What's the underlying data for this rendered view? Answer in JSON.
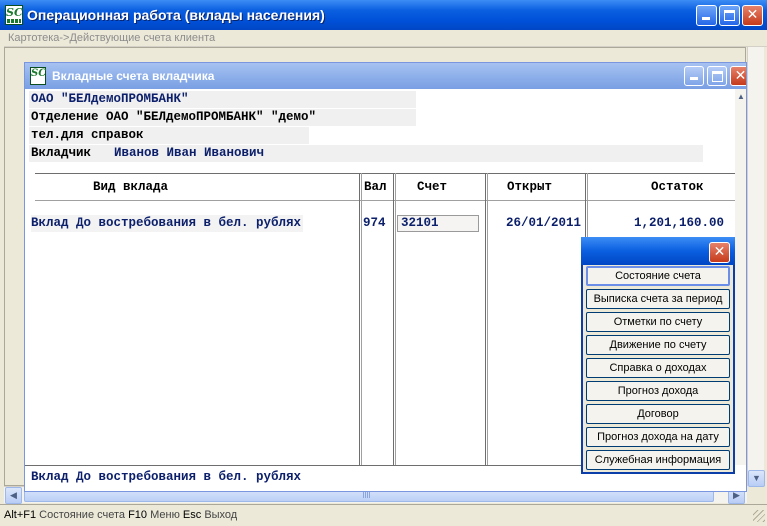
{
  "app": {
    "title": "Операционная работа (вклады населения)",
    "icon_text": "SC"
  },
  "breadcrumb": "Картотека->Действующие счета клиента",
  "inner_window": {
    "title": "Вкладные счета вкладчика",
    "icon_text": "SC",
    "bank": "ОАО \"БЕЛдемоПРОМБАНК\"",
    "branch": "Отделение ОАО \"БЕЛдемоПРОМБАНК\" \"демо\"",
    "phone_label": "тел.для  справок",
    "depositor_label": "Вкладчик",
    "depositor_name": "Иванов Иван Иванович"
  },
  "table": {
    "columns": [
      "Вид вклада",
      "Вал",
      "Счет",
      "Открыт",
      "Остаток"
    ],
    "rows": [
      {
        "type": "Вклад До востребования в бел. рублях",
        "currency": "974",
        "account": "32101",
        "opened": "26/01/2011",
        "balance": "1,201,160.00"
      }
    ]
  },
  "footer_text": "Вклад До востребования в бел. рублях",
  "popup_menu": {
    "items": [
      "Состояние счета",
      "Выписка счета за период",
      "Отметки по счету",
      "Движение по счету",
      "Справка о доходах",
      "Прогноз дохода",
      "Договор",
      "Прогноз дохода на дату",
      "Служебная информация"
    ]
  },
  "statusbar": {
    "k1": "Alt+F1",
    "d1": "Состояние счета",
    "k2": "F10",
    "d2": "Меню",
    "k3": "Esc",
    "d3": "Выход"
  },
  "icons": {
    "minimize": "minimize-icon",
    "maximize": "maximize-icon",
    "close": "close-icon",
    "scroll_left": "arrow-left-icon",
    "scroll_right": "arrow-right-icon",
    "scroll_down": "arrow-down-icon",
    "scroll_up": "arrow-up-icon"
  },
  "colors": {
    "titlebar": "#0a5fe0",
    "inner_titlebar": "#8eb0ea",
    "text_navy": "#0b1f6b",
    "close_button": "#c63a1c"
  }
}
